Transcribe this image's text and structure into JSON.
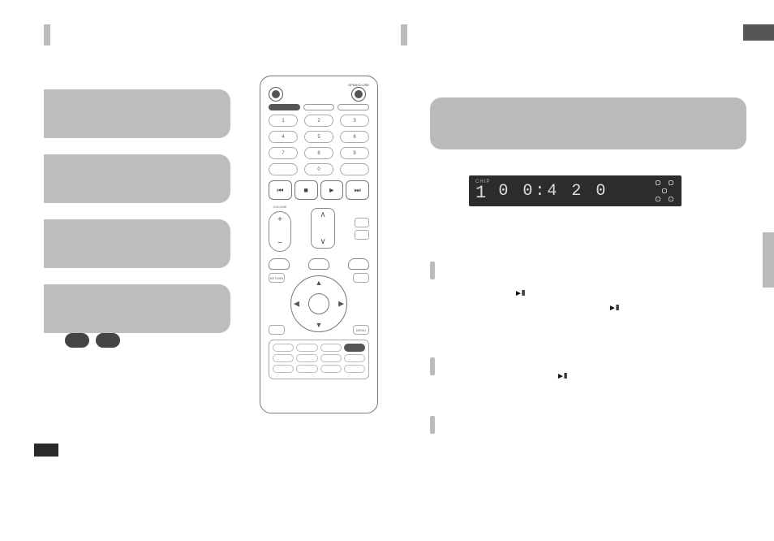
{
  "domain": "Document",
  "accents": {
    "left_bar": "",
    "mid_bar": ""
  },
  "corner_tab": "",
  "side_tab": "",
  "left_column": {
    "step1": "",
    "step2": "",
    "step3": "",
    "step4": "",
    "pill_a": "",
    "pill_b": "",
    "note_label": ""
  },
  "remote": {
    "top_right_label": "OPEN/CLOSE",
    "slim_label": "",
    "numpad": [
      "1",
      "2",
      "3",
      "4",
      "5",
      "6",
      "7",
      "8",
      "9",
      "",
      "0",
      ""
    ],
    "transport": {
      "prev": "⏮",
      "stop": "■",
      "play": "►",
      "next": "⏭"
    },
    "vol_label": "VOLUME",
    "vol_plus": "+",
    "vol_minus": "−",
    "ch_up": "∧",
    "ch_dn": "∨",
    "corner_tl": "RETURN",
    "corner_tr": "",
    "corner_bl": "",
    "corner_br": "MENU",
    "bottom_rows": [
      [
        "",
        "",
        "",
        ""
      ],
      [
        "",
        "",
        "",
        ""
      ],
      [
        "",
        "",
        "",
        ""
      ]
    ]
  },
  "right_column": {
    "intro_box": ""
  },
  "vfd": {
    "chip_label": "CHIP",
    "track": "1",
    "time": "0 0:4 2 0"
  },
  "glyphs": {
    "play_pause": "►II"
  }
}
